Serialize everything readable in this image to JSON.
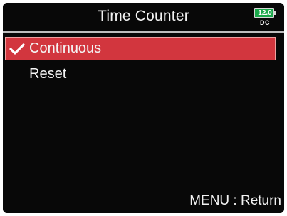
{
  "header": {
    "title": "Time Counter",
    "battery": {
      "voltage": "12.0",
      "source": "DC",
      "color": "#1aa84a"
    }
  },
  "menu": {
    "items": [
      {
        "label": "Continuous",
        "selected": true,
        "checked": true,
        "check_icon": "checkmark-icon"
      },
      {
        "label": "Reset",
        "selected": false,
        "checked": false
      }
    ],
    "highlight_color": "#d2363e"
  },
  "footer": {
    "hint": "MENU : Return"
  }
}
